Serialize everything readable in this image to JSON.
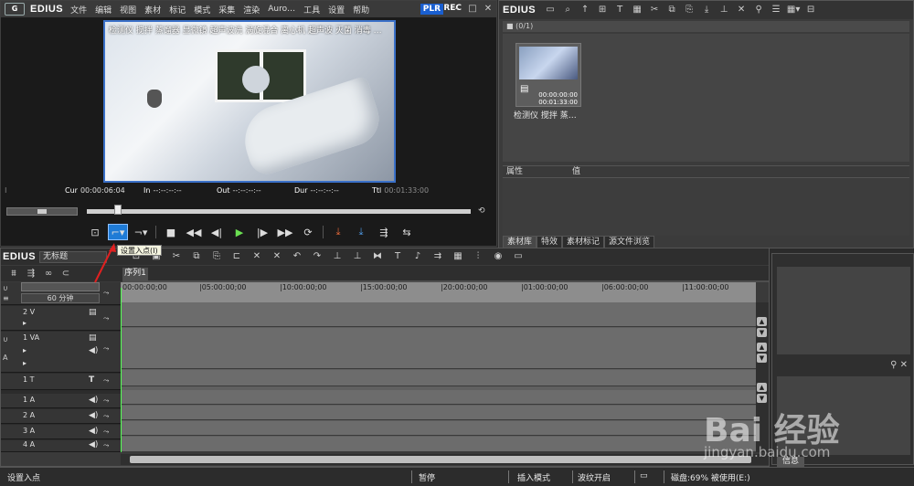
{
  "player": {
    "logo": "G",
    "app_name": "EDIUS",
    "menus": [
      "文件",
      "编辑",
      "视图",
      "素材",
      "标记",
      "模式",
      "采集",
      "渲染",
      "Auro…",
      "工具",
      "设置",
      "帮助"
    ],
    "plr": "PLR",
    "rec": "REC",
    "video_overlay": "检测仪 搅拌 蒸馏器 显微镜 超声波洗 涡旋混合 离心机 超声波 灭菌 消毒 …",
    "timecodes": {
      "cur_label": "Cur",
      "cur_value": "00:00:06:04",
      "in_label": "In",
      "in_value": "--:--:--:--",
      "out_label": "Out",
      "out_value": "--:--:--:--",
      "dur_label": "Dur",
      "dur_value": "--:--:--:--",
      "ttl_label": "Ttl",
      "ttl_value": "00:01:33:00"
    },
    "tooltip": "设置入点(I)"
  },
  "bin": {
    "app_name": "EDIUS",
    "folder": "■ (0/1)",
    "clip": {
      "tc1": "00:00:00:00",
      "tc2": "00:01:33:00",
      "name": "检测仪 搅拌 蒸…"
    },
    "prop_col1": "属性",
    "prop_col2": "值",
    "tabs": [
      "素材库",
      "特效",
      "素材标记",
      "源文件浏览"
    ]
  },
  "timeline": {
    "app_name": "EDIUS",
    "sequence_name": "无标题",
    "sequence_tab": "序列1",
    "zoom_label": "60 分钟",
    "ruler": [
      "00:00:00;00",
      "|05:00:00;00",
      "|10:00:00;00",
      "|15:00:00;00",
      "|20:00:00;00",
      "|01:00:00;00",
      "|06:00:00;00",
      "|11:00:00;00"
    ],
    "tracks": [
      {
        "name": "2 V"
      },
      {
        "name": "1 VA"
      },
      {
        "name": "1 T"
      },
      {
        "name": "1 A"
      },
      {
        "name": "2 A"
      },
      {
        "name": "3 A"
      },
      {
        "name": "4 A"
      }
    ]
  },
  "palette": {
    "info_tab": "信息"
  },
  "status": {
    "left": "设置入点",
    "pause": "暂停",
    "mode": "插入模式",
    "ripple": "波纹开启",
    "disk": "磁盘:69% 被使用(E:)"
  },
  "watermark": {
    "brand": "Bai 经验",
    "site": "jingyan.baidu.com"
  },
  "colors": {
    "accent": "#1f7bd6",
    "playhead": "#55ff55",
    "play_button": "#6be052"
  }
}
